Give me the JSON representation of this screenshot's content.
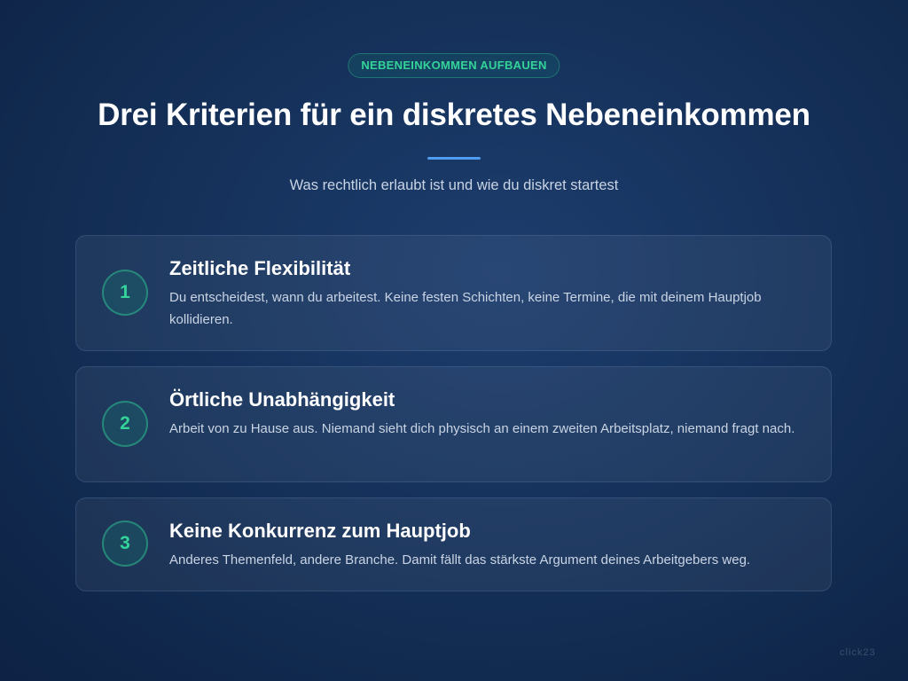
{
  "badge": "NEBENEINKOMMEN AUFBAUEN",
  "title": "Drei Kriterien für ein diskretes Nebeneinkommen",
  "subtitle": "Was rechtlich erlaubt ist und wie du diskret startest",
  "colors": {
    "accent": "#34d399",
    "divider": "#4f9cf0",
    "background": "#17345f"
  },
  "criteria": [
    {
      "number": "1",
      "title": "Zeitliche Flexibilität",
      "description": "Du entscheidest, wann du arbeitest. Keine festen Schichten, keine Termine, die mit deinem Hauptjob kollidieren."
    },
    {
      "number": "2",
      "title": "Örtliche Unabhängigkeit",
      "description": "Arbeit von zu Hause aus. Niemand sieht dich physisch an einem zweiten Arbeitsplatz, niemand fragt nach."
    },
    {
      "number": "3",
      "title": "Keine Konkurrenz zum Hauptjob",
      "description": "Anderes Themenfeld, andere Branche. Damit fällt das stärkste Argument deines Arbeitgebers weg."
    }
  ],
  "watermark": "click23"
}
